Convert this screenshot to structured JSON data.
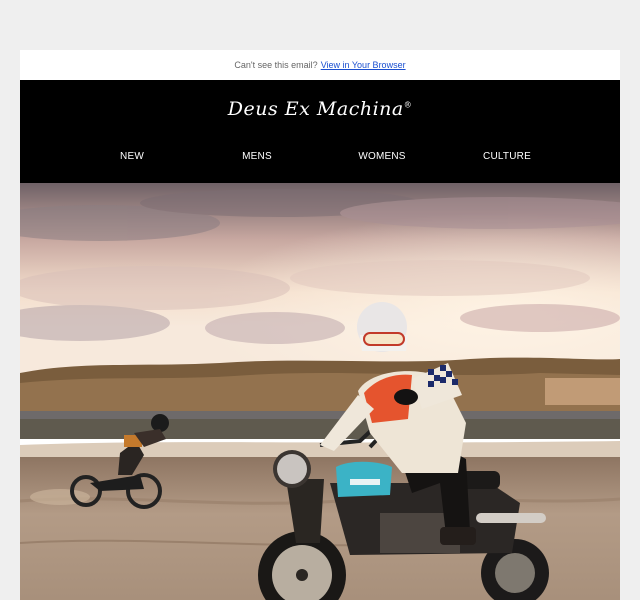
{
  "preheader": {
    "text": "Can't see this email?",
    "link": "View in Your Browser"
  },
  "header": {
    "logo": "Deus Ex Machina",
    "logo_mark": "®",
    "nav": [
      "NEW",
      "MENS",
      "WOMENS",
      "CULTURE"
    ]
  },
  "hero": {
    "subject": "motorcycle-riders-on-sand-at-sunset",
    "colors": {
      "sky_top": "#7d6e72",
      "sky_glow": "#f3ddc9",
      "dune": "#8a6a44",
      "sand": "#b99e86",
      "tank": "#3bb3c6",
      "jersey": "#eee5d6",
      "jersey_accent": "#e5542e"
    }
  }
}
